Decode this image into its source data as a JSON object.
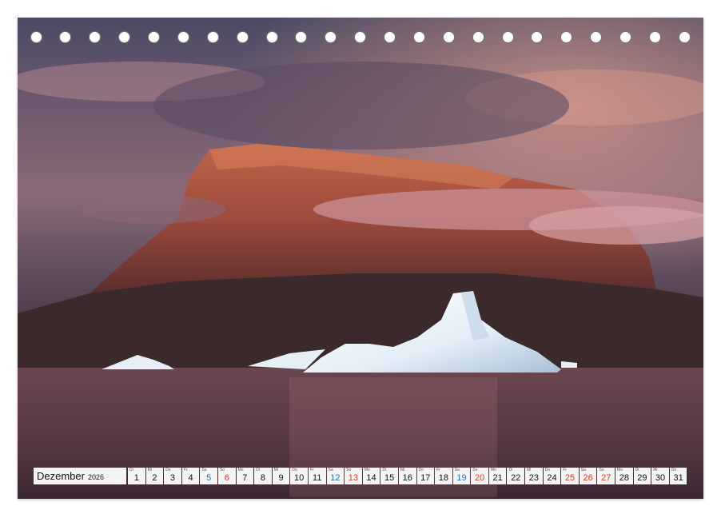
{
  "calendar": {
    "month": "Dezember",
    "year": "2026",
    "days": [
      {
        "num": "1",
        "wd": "Di",
        "type": "normal"
      },
      {
        "num": "2",
        "wd": "Mi",
        "type": "normal"
      },
      {
        "num": "3",
        "wd": "Do",
        "type": "normal"
      },
      {
        "num": "4",
        "wd": "Fr",
        "type": "normal"
      },
      {
        "num": "5",
        "wd": "Sa",
        "type": "sat"
      },
      {
        "num": "6",
        "wd": "So",
        "type": "sun"
      },
      {
        "num": "7",
        "wd": "Mo",
        "type": "normal"
      },
      {
        "num": "8",
        "wd": "Di",
        "type": "normal"
      },
      {
        "num": "9",
        "wd": "Mi",
        "type": "normal"
      },
      {
        "num": "10",
        "wd": "Do",
        "type": "normal"
      },
      {
        "num": "11",
        "wd": "Fr",
        "type": "normal"
      },
      {
        "num": "12",
        "wd": "Sa",
        "type": "sat"
      },
      {
        "num": "13",
        "wd": "So",
        "type": "sun"
      },
      {
        "num": "14",
        "wd": "Mo",
        "type": "normal"
      },
      {
        "num": "15",
        "wd": "Di",
        "type": "normal"
      },
      {
        "num": "16",
        "wd": "Mi",
        "type": "normal"
      },
      {
        "num": "17",
        "wd": "Do",
        "type": "normal"
      },
      {
        "num": "18",
        "wd": "Fr",
        "type": "normal"
      },
      {
        "num": "19",
        "wd": "Sa",
        "type": "sat"
      },
      {
        "num": "20",
        "wd": "So",
        "type": "sun"
      },
      {
        "num": "21",
        "wd": "Mo",
        "type": "normal"
      },
      {
        "num": "22",
        "wd": "Di",
        "type": "normal"
      },
      {
        "num": "23",
        "wd": "Mi",
        "type": "normal"
      },
      {
        "num": "24",
        "wd": "Do",
        "type": "normal"
      },
      {
        "num": "25",
        "wd": "Fr",
        "type": "hol"
      },
      {
        "num": "26",
        "wd": "Sa",
        "type": "hol"
      },
      {
        "num": "27",
        "wd": "So",
        "type": "sun"
      },
      {
        "num": "28",
        "wd": "Mo",
        "type": "normal"
      },
      {
        "num": "29",
        "wd": "Di",
        "type": "normal"
      },
      {
        "num": "30",
        "wd": "Mi",
        "type": "normal"
      },
      {
        "num": "31",
        "wd": "Do",
        "type": "normal"
      }
    ]
  },
  "colors": {
    "sunday": "#d23a2a",
    "saturday": "#2f6fa8",
    "cell": "#f4f4f4"
  }
}
